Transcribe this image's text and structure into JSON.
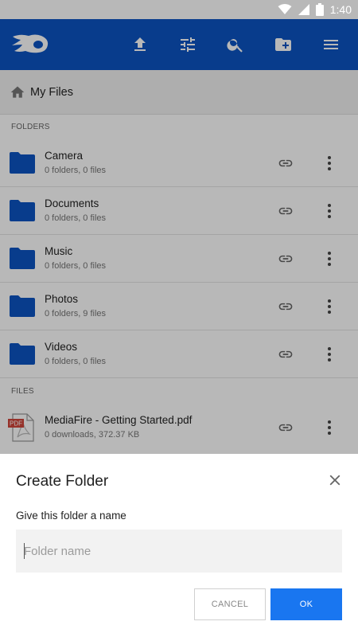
{
  "status_bar": {
    "time": "1:40"
  },
  "breadcrumb": {
    "title": "My Files"
  },
  "sections": {
    "folders": "FOLDERS",
    "files": "FILES"
  },
  "folders": [
    {
      "name": "Camera",
      "meta": "0 folders, 0 files"
    },
    {
      "name": "Documents",
      "meta": "0 folders, 0 files"
    },
    {
      "name": "Music",
      "meta": "0 folders, 0 files"
    },
    {
      "name": "Photos",
      "meta": "0 folders, 9 files"
    },
    {
      "name": "Videos",
      "meta": "0 folders, 0 files"
    }
  ],
  "files": [
    {
      "name": "MediaFire - Getting Started.pdf",
      "meta": "0 downloads, 372.37 KB",
      "badge": "PDF"
    }
  ],
  "dialog": {
    "title": "Create Folder",
    "prompt": "Give this folder a name",
    "placeholder": "Folder name",
    "value": "",
    "cancel_label": "CANCEL",
    "ok_label": "OK"
  },
  "colors": {
    "brand": "#0c54c2",
    "folder": "#0c54c2",
    "ok": "#1976f0",
    "pdf": "#d0463b"
  },
  "icons": {
    "appbar": [
      "mediafire-logo-icon",
      "upload-icon",
      "sort-tune-icon",
      "search-icon",
      "new-folder-icon",
      "menu-icon"
    ],
    "row": [
      "folder-icon",
      "link-icon",
      "more-vert-icon"
    ]
  }
}
